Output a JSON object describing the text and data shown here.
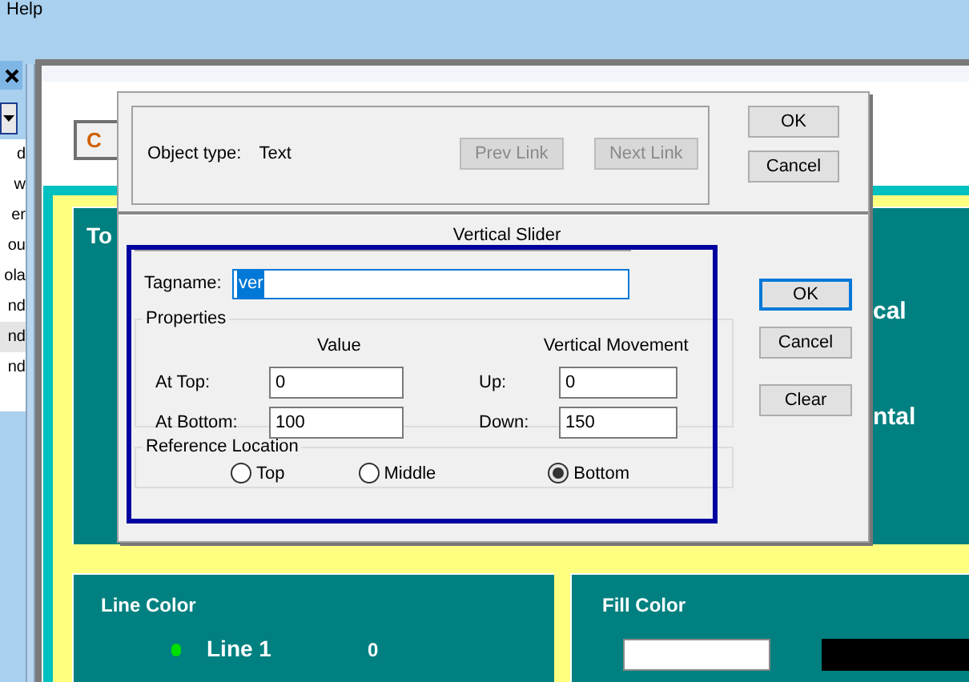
{
  "menu_bar": {
    "items": [
      "Help"
    ]
  },
  "background_window": {
    "side_list": {
      "items": [
        {
          "label": "d",
          "selected": false
        },
        {
          "label": "w",
          "selected": false
        },
        {
          "label": "er",
          "selected": false
        },
        {
          "label": "ou",
          "selected": false
        },
        {
          "label": "ola",
          "selected": false
        },
        {
          "label": "nd",
          "selected": false
        },
        {
          "label": "nd",
          "selected": true
        },
        {
          "label": "nd",
          "selected": false
        }
      ]
    },
    "button_text": "C",
    "top_left_title": "To",
    "right_texts": [
      "cal",
      "ntal"
    ],
    "line_color_panel": {
      "title": "Line Color",
      "lines": [
        {
          "label": "Line 1",
          "value": "0",
          "color": "#00e000"
        }
      ]
    },
    "fill_color_panel": {
      "title": "Fill Color"
    }
  },
  "object_dialog": {
    "object_type_label": "Object type:",
    "object_type": "Text",
    "link_buttons": [
      {
        "label": "Prev Link",
        "disabled": true
      },
      {
        "label": "Next Link",
        "disabled": true
      }
    ],
    "buttons": [
      "OK",
      "Cancel"
    ]
  },
  "slider_dialog": {
    "title": "Vertical Slider",
    "tagname_label": "Tagname:",
    "tagname": "ver",
    "properties": {
      "title": "Properties",
      "value_header": "Value",
      "movement_header": "Vertical Movement",
      "rows": [
        {
          "label": "At Top:",
          "value": "0",
          "movement_label": "Up:",
          "movement": "0"
        },
        {
          "label": "At Bottom:",
          "value": "100",
          "movement_label": "Down:",
          "movement": "150"
        }
      ]
    },
    "reference": {
      "title": "Reference Location",
      "options": [
        {
          "label": "Top",
          "selected": false
        },
        {
          "label": "Middle",
          "selected": false
        },
        {
          "label": "Bottom",
          "selected": true
        }
      ]
    },
    "buttons": [
      {
        "label": "OK",
        "default": true
      },
      {
        "label": "Cancel",
        "default": false
      },
      {
        "label": "Clear",
        "default": false
      }
    ]
  }
}
